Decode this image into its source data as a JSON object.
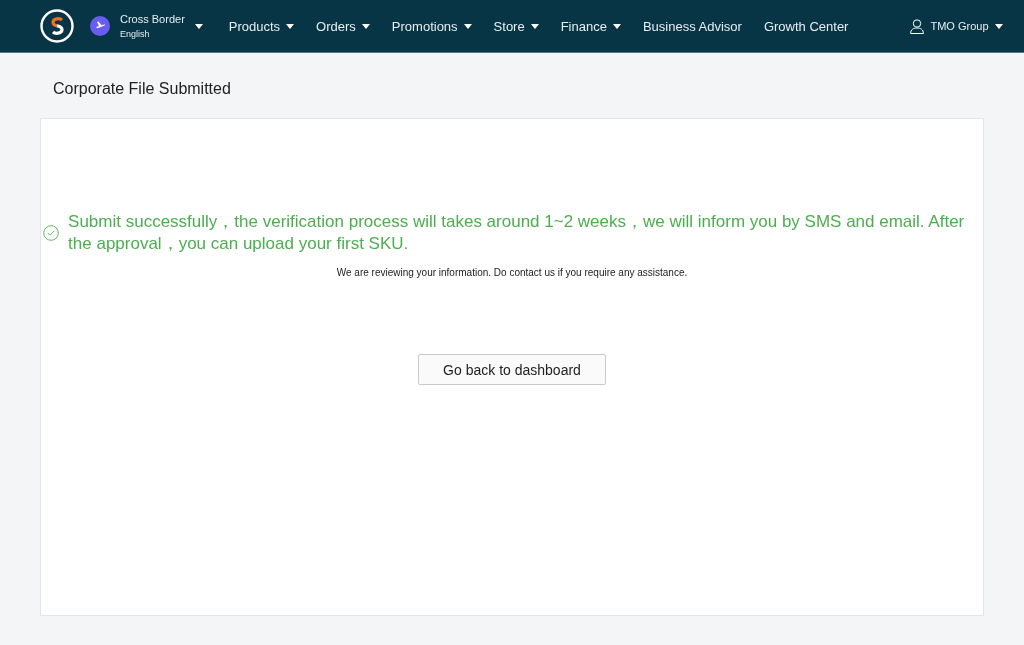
{
  "nav": {
    "channel": {
      "name": "Cross Border",
      "language": "English"
    },
    "items": [
      {
        "label": "Products",
        "dropdown": true
      },
      {
        "label": "Orders",
        "dropdown": true
      },
      {
        "label": "Promotions",
        "dropdown": true
      },
      {
        "label": "Store",
        "dropdown": true
      },
      {
        "label": "Finance",
        "dropdown": true
      },
      {
        "label": "Business Advisor",
        "dropdown": false
      },
      {
        "label": "Growth Center",
        "dropdown": false
      }
    ],
    "user": "TMO Group"
  },
  "page_title": "Corporate File Submitted",
  "result": {
    "message": "Submit successfully，the verification process will takes around 1~2 weeks，we will inform you by SMS and email. After the approval，you can upload your first SKU.",
    "note": "We are reviewing your information. Do contact us if you require any assistance.",
    "button": "Go back to dashboard"
  }
}
